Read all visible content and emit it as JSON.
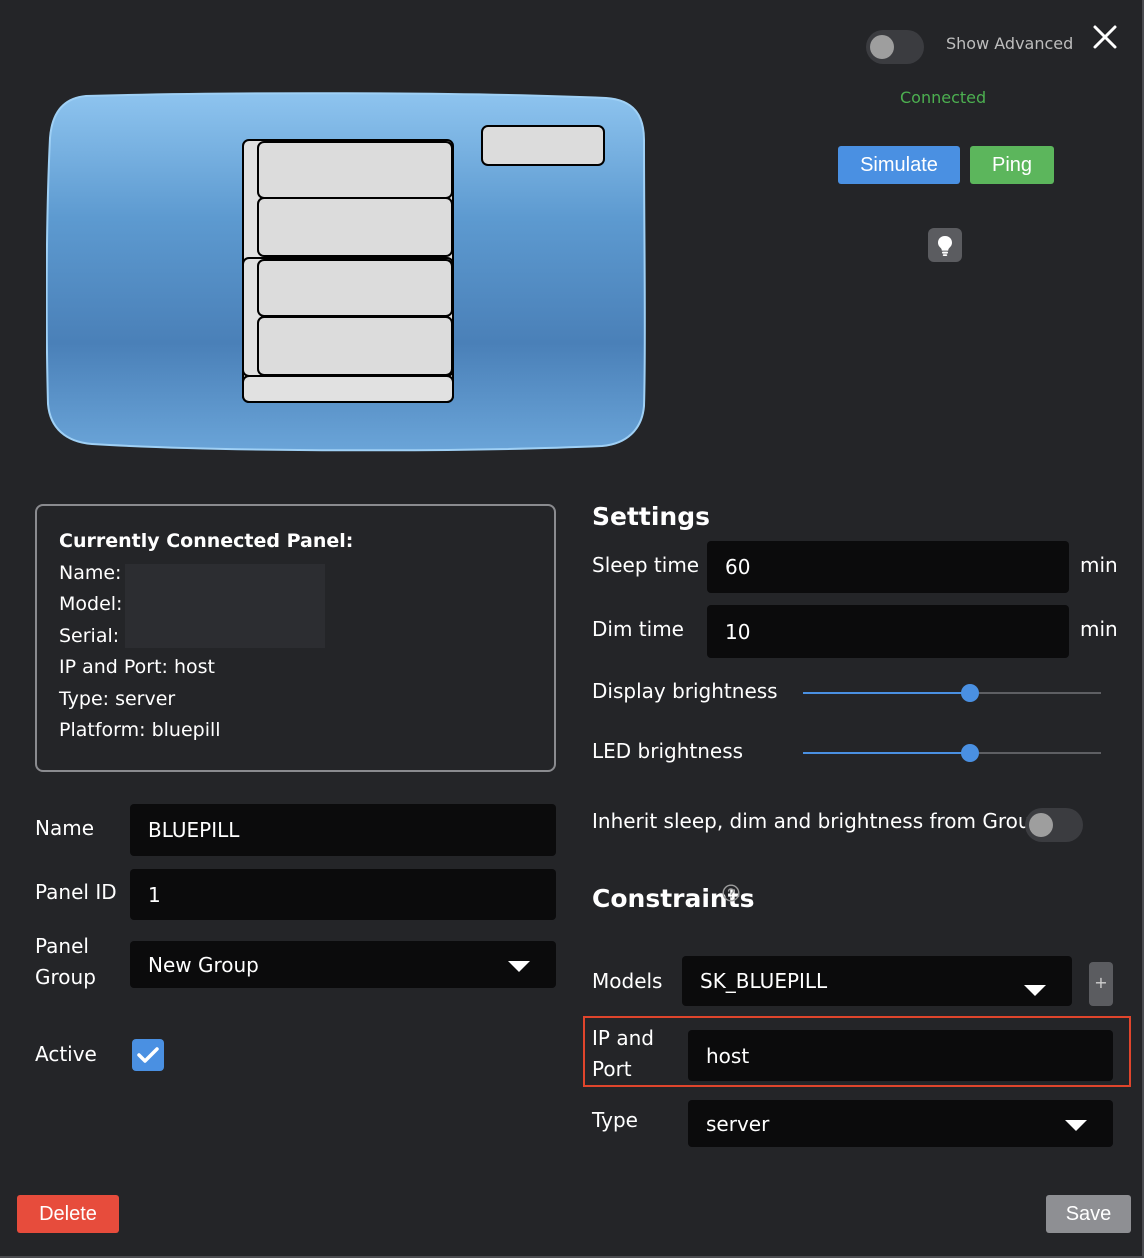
{
  "header": {
    "show_advanced_label": "Show Advanced",
    "status": "Connected",
    "simulate_label": "Simulate",
    "ping_label": "Ping"
  },
  "connected_panel": {
    "heading": "Currently Connected Panel:",
    "name": "Name: ",
    "model": "Model: ",
    "serial": "Serial: ",
    "ip_port": "IP and Port: host",
    "type": "Type: server",
    "platform": "Platform: bluepill"
  },
  "form": {
    "name_label": "Name",
    "name_value": "BLUEPILL",
    "panel_id_label": "Panel ID",
    "panel_id_value": "1",
    "panel_group_label_1": "Panel",
    "panel_group_label_2": "Group",
    "panel_group_value": "New Group",
    "active_label": "Active",
    "active_checked": true
  },
  "settings": {
    "heading": "Settings",
    "sleep_label": "Sleep time",
    "sleep_value": "60",
    "sleep_unit": "min",
    "dim_label": "Dim time",
    "dim_value": "10",
    "dim_unit": "min",
    "display_brightness_label": "Display brightness",
    "display_brightness_level": 0.56,
    "led_brightness_label": "LED brightness",
    "led_brightness_level": 0.56,
    "inherit_label": "Inherit sleep, dim and brightness from Group",
    "inherit_on": false
  },
  "constraints": {
    "heading": "Constraints",
    "models_label": "Models",
    "models_value": "SK_BLUEPILL",
    "plus_label": "+",
    "ip_label_1": "IP and",
    "ip_label_2": "Port",
    "ip_value": "host",
    "type_label": "Type",
    "type_value": "server"
  },
  "footer": {
    "delete_label": "Delete",
    "save_label": "Save"
  },
  "colors": {
    "background": "#242528",
    "accent_blue": "#4a90e2",
    "success_green": "#5cb65c",
    "danger_red": "#e74c3c",
    "highlight_border": "#e0452c"
  }
}
